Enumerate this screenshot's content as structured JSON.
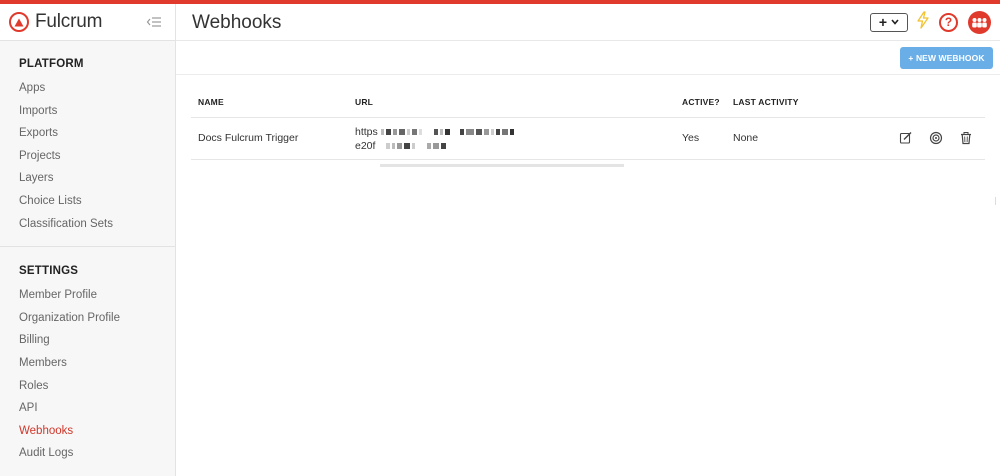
{
  "app": {
    "name": "Fulcrum",
    "accent_color": "#e03a2d",
    "link_active_color": "#d0372b",
    "icons": {
      "logo": "fulcrum-triangle-logo",
      "collapse": "collapse-sidebar-icon",
      "add": "plus-icon",
      "dropdown": "chevron-down-icon",
      "bolt": "lightning-bolt-icon",
      "help": "question-circle-icon",
      "avatar": "org-avatar-icon"
    }
  },
  "sidebar": {
    "platform": {
      "heading": "PLATFORM",
      "items": [
        "Apps",
        "Imports",
        "Exports",
        "Projects",
        "Layers",
        "Choice Lists",
        "Classification Sets"
      ]
    },
    "settings": {
      "heading": "SETTINGS",
      "items": [
        "Member Profile",
        "Organization Profile",
        "Billing",
        "Members",
        "Roles",
        "API",
        "Webhooks",
        "Audit Logs"
      ],
      "active": "Webhooks"
    }
  },
  "header": {
    "title": "Webhooks",
    "add_symbol": "+",
    "help_symbol": "?"
  },
  "toolbar": {
    "new_webhook_label": "+ NEW WEBHOOK",
    "button_color": "#6aaee8"
  },
  "table": {
    "columns": {
      "name": "NAME",
      "url": "URL",
      "active": "ACTIVE?",
      "last_activity": "LAST ACTIVITY"
    },
    "rows": [
      {
        "name": "Docs Fulcrum Trigger",
        "url_line1": "https",
        "url_line2": "e20f",
        "url_redacted": true,
        "active": "Yes",
        "last_activity": "None",
        "actions": [
          "edit-icon",
          "target-icon",
          "trash-icon"
        ]
      }
    ]
  }
}
